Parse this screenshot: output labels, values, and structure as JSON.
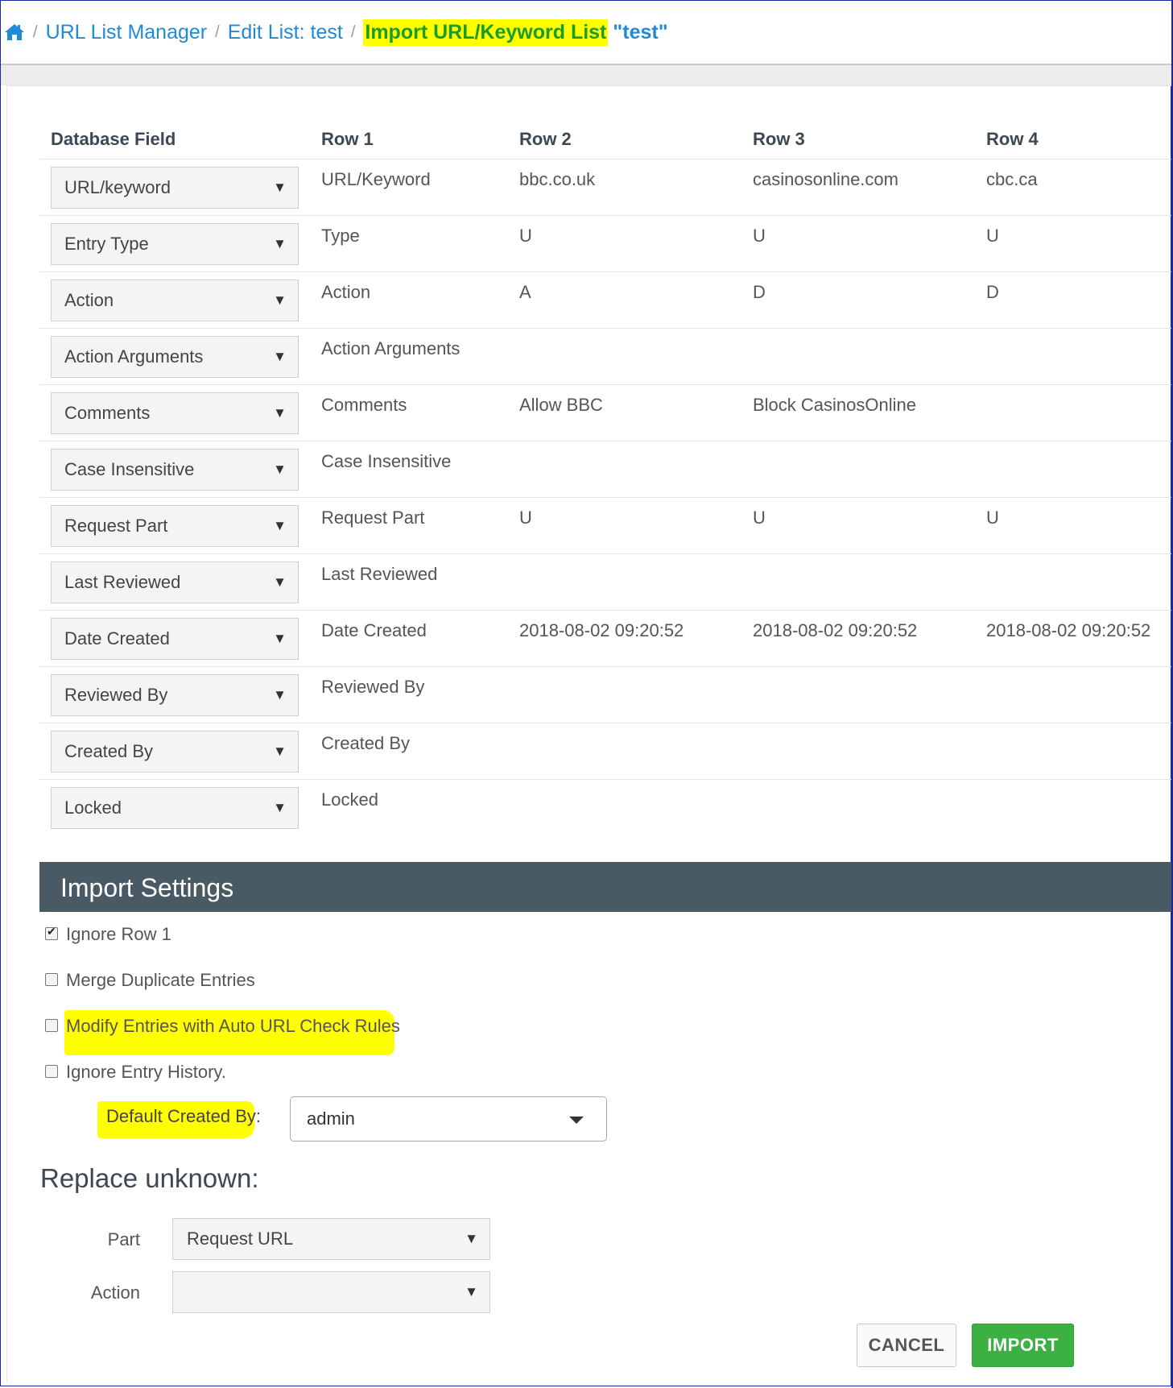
{
  "breadcrumb": {
    "items": [
      "URL List Manager",
      "Edit List: test"
    ],
    "current": "Import URL/Keyword List",
    "current_quote": "\"test\""
  },
  "table": {
    "headers": [
      "Database Field",
      "Row 1",
      "Row 2",
      "Row 3",
      "Row 4"
    ],
    "rows": [
      {
        "field": "URL/keyword",
        "cells": [
          "URL/Keyword",
          "bbc.co.uk",
          "casinosonline.com",
          "cbc.ca"
        ]
      },
      {
        "field": "Entry Type",
        "cells": [
          "Type",
          "U",
          "U",
          "U"
        ]
      },
      {
        "field": "Action",
        "cells": [
          "Action",
          "A",
          "D",
          "D"
        ]
      },
      {
        "field": "Action Arguments",
        "cells": [
          "Action Arguments",
          "",
          "",
          ""
        ]
      },
      {
        "field": "Comments",
        "cells": [
          "Comments",
          "Allow BBC",
          "Block CasinosOnline",
          ""
        ]
      },
      {
        "field": "Case Insensitive",
        "cells": [
          "Case Insensitive",
          "",
          "",
          ""
        ]
      },
      {
        "field": "Request Part",
        "cells": [
          "Request Part",
          "U",
          "U",
          "U"
        ]
      },
      {
        "field": "Last Reviewed",
        "cells": [
          "Last Reviewed",
          "",
          "",
          ""
        ]
      },
      {
        "field": "Date Created",
        "cells": [
          "Date Created",
          "2018-08-02 09:20:52",
          "2018-08-02 09:20:52",
          "2018-08-02 09:20:52"
        ]
      },
      {
        "field": "Reviewed By",
        "cells": [
          "Reviewed By",
          "",
          "",
          ""
        ]
      },
      {
        "field": "Created By",
        "cells": [
          "Created By",
          "",
          "",
          ""
        ]
      },
      {
        "field": "Locked",
        "cells": [
          "Locked",
          "",
          "",
          ""
        ]
      }
    ]
  },
  "settings": {
    "title": "Import Settings",
    "options": [
      {
        "label": "Ignore Row 1",
        "checked": true
      },
      {
        "label": "Merge Duplicate Entries",
        "checked": false
      },
      {
        "label": "Modify Entries with Auto URL Check Rules",
        "checked": false
      },
      {
        "label": "Ignore Entry History.",
        "checked": false
      }
    ],
    "default_created_by_label": "Default Created By",
    "default_created_by_value": "admin"
  },
  "replace": {
    "title": "Replace unknown:",
    "part_label": "Part",
    "part_value": "Request URL",
    "action_label": "Action",
    "action_value": ""
  },
  "buttons": {
    "cancel": "CANCEL",
    "import": "IMPORT"
  },
  "icons": {
    "home": "home-icon",
    "dropdown": "caret-down-icon"
  },
  "colors": {
    "link": "#1f8ad6",
    "current": "#1a9c2a",
    "highlight": "#ffff00",
    "settings_bar": "#4a5a65",
    "import_button": "#3cb043"
  }
}
